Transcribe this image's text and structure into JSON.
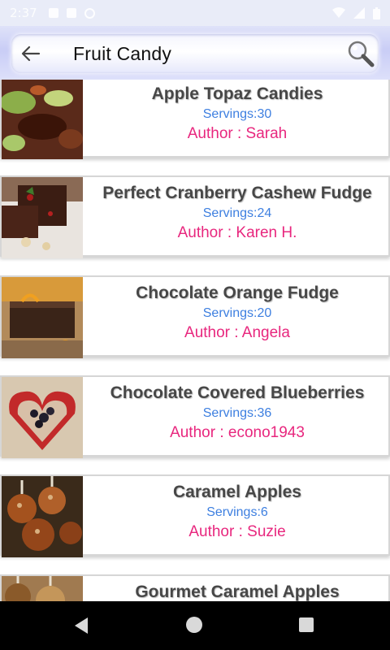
{
  "status_bar": {
    "time": "2:37"
  },
  "search": {
    "query": "Fruit Candy"
  },
  "recipes": [
    {
      "title": "Apple Topaz Candies",
      "servings": "Servings:30",
      "author": "Author : Sarah"
    },
    {
      "title": "Perfect Cranberry Cashew Fudge",
      "servings": "Servings:24",
      "author": "Author : Karen H."
    },
    {
      "title": "Chocolate Orange Fudge",
      "servings": "Servings:20",
      "author": "Author : Angela"
    },
    {
      "title": "Chocolate Covered Blueberries",
      "servings": "Servings:36",
      "author": "Author : econo1943"
    },
    {
      "title": "Caramel Apples",
      "servings": "Servings:6",
      "author": "Author : Suzie"
    },
    {
      "title": "Gourmet Caramel Apples",
      "servings": "",
      "author": ""
    }
  ],
  "colors": {
    "title": "#474747",
    "servings": "#3d7fe0",
    "author": "#e8277e",
    "search_bar": "#c9cdf6"
  }
}
